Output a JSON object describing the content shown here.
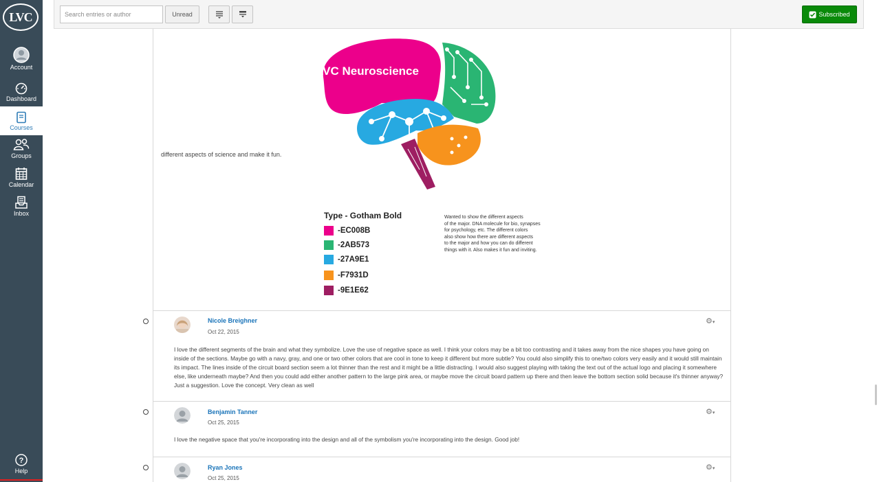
{
  "nav": {
    "logo": "LVC",
    "items": [
      {
        "label": "Account",
        "icon": "user-avatar-icon"
      },
      {
        "label": "Dashboard",
        "icon": "dashboard-gauge-icon"
      },
      {
        "label": "Courses",
        "icon": "courses-book-icon"
      },
      {
        "label": "Groups",
        "icon": "groups-people-icon"
      },
      {
        "label": "Calendar",
        "icon": "calendar-icon"
      },
      {
        "label": "Inbox",
        "icon": "inbox-tray-icon"
      }
    ],
    "help": "Help",
    "active": "Courses"
  },
  "toolbar": {
    "search_placeholder": "Search entries or author",
    "unread_label": "Unread",
    "subscribed_label": "Subscribed",
    "subscribed_color": "#0a8a0a"
  },
  "post": {
    "text": "different aspects of science and make it fun.",
    "image": {
      "title": "LVC Neuroscience",
      "type_title": "Type - Gotham Bold",
      "swatches": [
        {
          "color": "#EC008B",
          "label": "-EC008B"
        },
        {
          "color": "#2AB573",
          "label": "-2AB573"
        },
        {
          "color": "#27A9E1",
          "label": "-27A9E1"
        },
        {
          "color": "#F7931D",
          "label": "-F7931D"
        },
        {
          "color": "#9E1E62",
          "label": "-9E1E62"
        }
      ],
      "note_lines": [
        "Wanted to show the different aspects",
        "of the major. DNA molecule for bio, synapses",
        "for psychology, etc. The different colors",
        "also show how there are different aspects",
        "to the major and how you can do different",
        "things with it. Also makes it fun and inviting."
      ]
    }
  },
  "replies": [
    {
      "author": "Nicole Breighner",
      "date": "Oct 22, 2015",
      "body": "I love the different segments of the brain and what they symbolize. Love the use of negative space as well. I think your colors may be a bit too contrasting and it takes  away from the nice shapes you have going on inside of the sections. Maybe go with a navy, gray, and one or two other colors that are cool in tone to keep it different but more subtle? You could also simplify this to one/two colors very easily and it would still maintain its impact. The lines inside of the circuit board section seem a lot thinner than the rest and it might be a little distracting. I would also suggest playing with taking the text out of the actual logo and placing it somewhere else, like underneath maybe? And then you could add either another pattern to the large pink area, or maybe move the circuit board pattern up there and then leave the bottom section solid because it's thinner anyway? Just a suggestion. Love the concept. Very clean as well"
    },
    {
      "author": "Benjamin Tanner",
      "date": "Oct 25, 2015",
      "body": "I love the negative space that you're incorporating into the design and all of the symbolism you're incorporating into the design. Good job!"
    },
    {
      "author": "Ryan Jones",
      "date": "Oct 25, 2015",
      "body": ""
    }
  ]
}
